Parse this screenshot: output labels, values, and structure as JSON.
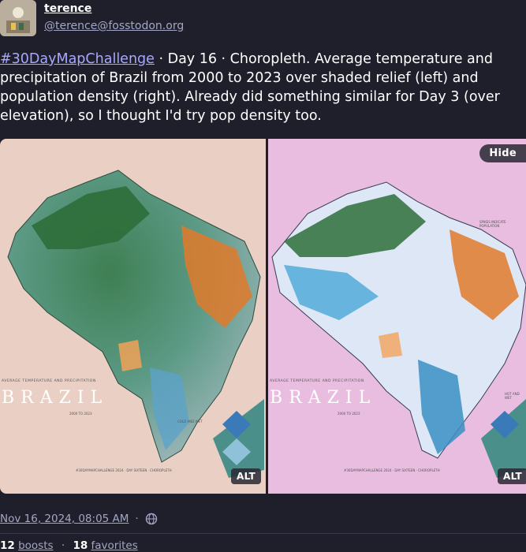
{
  "author": {
    "display_name": "terence",
    "handle": "@terence@fosstodon.org"
  },
  "status": {
    "hashtag": "#30DayMapChallenge",
    "text": " · Day 16 · Choropleth. Average temperature and precipitation of Brazil from 2000 to 2023 over shaded relief (left) and population density (right). Already did something similar for Day 3 (over elevation), so I thought I'd try pop density too."
  },
  "media": {
    "hide_label": "Hide",
    "alt_left": "ALT",
    "alt_right": "ALT",
    "map_title": "BRAZIL",
    "map_subtitle": "AVERAGE TEMPERATURE AND PRECIPITATION",
    "map_years": "2000 TO 2023",
    "map_credit": "#30DAYMAPCHALLENGE 2024 · DAY SIXTEEN · CHOROPLETH",
    "legend_cold_wet": "COLD AND WET",
    "legend_hot_wet": "HOT AND WET",
    "right_note": "SPIKES INDICATE POPULATION",
    "colors": {
      "green": "#2e6e3a",
      "orange": "#e07a2a",
      "blue": "#3a8fc4",
      "bg_left": "#e9cfc4",
      "bg_right": "#e8bde0"
    }
  },
  "meta": {
    "date": "Nov 16, 2024, 08:05 AM",
    "separator": "·",
    "visibility_icon": "globe-icon"
  },
  "counts": {
    "boosts": "12",
    "boosts_label": "boosts",
    "sep": "·",
    "favorites": "18",
    "favorites_label": "favorites"
  }
}
